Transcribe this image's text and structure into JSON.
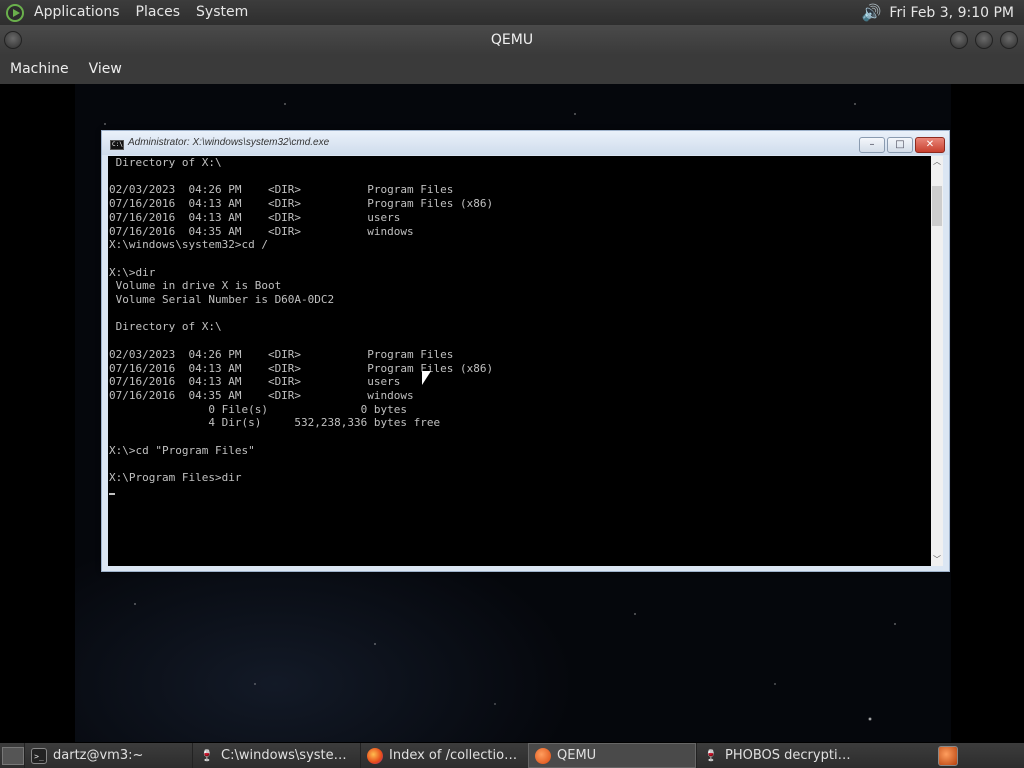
{
  "top_panel": {
    "menus": [
      "Applications",
      "Places",
      "System"
    ],
    "clock": "Fri Feb  3,  9:10 PM"
  },
  "qemu": {
    "title": "QEMU",
    "menus": [
      "Machine",
      "View"
    ]
  },
  "cmd_window": {
    "title": "Administrator: X:\\windows\\system32\\cmd.exe",
    "controls": {
      "minimize": "–",
      "maximize": "□",
      "close": "✕"
    },
    "console_text": " Directory of X:\\\n\n02/03/2023  04:26 PM    <DIR>          Program Files\n07/16/2016  04:13 AM    <DIR>          Program Files (x86)\n07/16/2016  04:13 AM    <DIR>          users\n07/16/2016  04:35 AM    <DIR>          windows\nX:\\windows\\system32>cd /\n\nX:\\>dir\n Volume in drive X is Boot\n Volume Serial Number is D60A-0DC2\n\n Directory of X:\\\n\n02/03/2023  04:26 PM    <DIR>          Program Files\n07/16/2016  04:13 AM    <DIR>          Program Files (x86)\n07/16/2016  04:13 AM    <DIR>          users\n07/16/2016  04:35 AM    <DIR>          windows\n               0 File(s)              0 bytes\n               4 Dir(s)     532,238,336 bytes free\n\nX:\\>cd \"Program Files\"\n\nX:\\Program Files>dir\n"
  },
  "taskbar": {
    "items": [
      {
        "label": "dartz@vm3:~",
        "icon": "terminal-icon"
      },
      {
        "label": "C:\\windows\\system...",
        "icon": "wine-icon"
      },
      {
        "label": "Index of /collection/...",
        "icon": "firefox-icon"
      },
      {
        "label": "QEMU",
        "icon": "qemu-icon",
        "active": true
      },
      {
        "label": "PHOBOS decryption...",
        "icon": "wine-icon"
      }
    ]
  }
}
